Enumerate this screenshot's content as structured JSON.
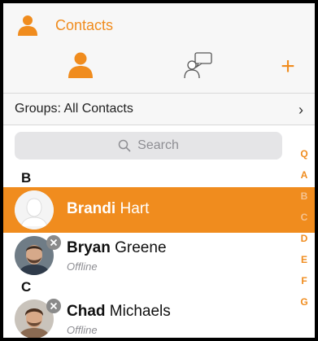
{
  "header": {
    "title": "Contacts",
    "icon": "person-icon"
  },
  "tabs": [
    {
      "name": "contacts",
      "icon": "person-icon"
    },
    {
      "name": "chats",
      "icon": "chat-bubbles-icon"
    },
    {
      "name": "add",
      "label": "+",
      "icon": "plus-icon"
    }
  ],
  "groups": {
    "label": "Groups: All Contacts",
    "chevron": "›"
  },
  "search": {
    "placeholder": "Search",
    "icon": "search-icon"
  },
  "sections": [
    {
      "letter": "B",
      "contacts": [
        {
          "first": "Brandi",
          "last": " Hart",
          "status": "",
          "selected": true
        },
        {
          "first": "Bryan",
          "last": " Greene",
          "status": "Offline",
          "selected": false
        }
      ]
    },
    {
      "letter": "C",
      "contacts": [
        {
          "first": "Chad",
          "last": " Michaels",
          "status": "Offline",
          "selected": false
        }
      ]
    }
  ],
  "index": [
    "Q",
    "A",
    "B",
    "C",
    "D",
    "E",
    "F",
    "G"
  ],
  "colors": {
    "accent": "#f08c1e",
    "selected_row": "#f08c1e",
    "status_text": "#8e8e93"
  }
}
